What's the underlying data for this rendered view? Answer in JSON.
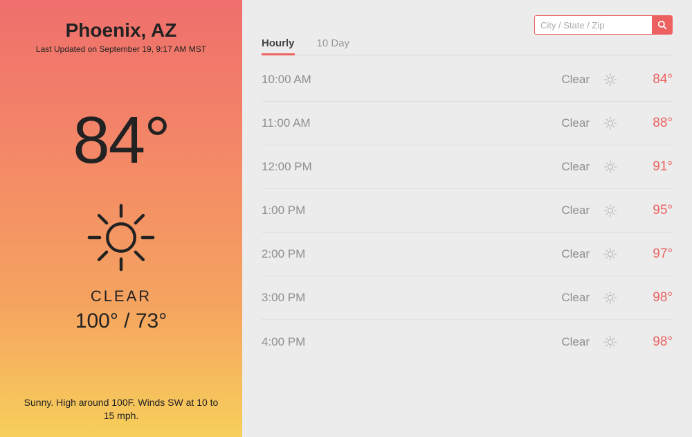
{
  "left": {
    "location": "Phoenix, AZ",
    "updated": "Last Updated on September 19, 9:17 AM MST",
    "temp": "84°",
    "condition": "CLEAR",
    "hi_lo": "100° / 73°",
    "summary": "Sunny. High around 100F. Winds SW at 10 to 15 mph."
  },
  "search": {
    "placeholder": "City / State / Zip"
  },
  "tabs": {
    "hourly": "Hourly",
    "tenday": "10 Day"
  },
  "rows": [
    {
      "time": "10:00 AM",
      "cond": "Clear",
      "temp": "84°"
    },
    {
      "time": "11:00 AM",
      "cond": "Clear",
      "temp": "88°"
    },
    {
      "time": "12:00 PM",
      "cond": "Clear",
      "temp": "91°"
    },
    {
      "time": "1:00 PM",
      "cond": "Clear",
      "temp": "95°"
    },
    {
      "time": "2:00 PM",
      "cond": "Clear",
      "temp": "97°"
    },
    {
      "time": "3:00 PM",
      "cond": "Clear",
      "temp": "98°"
    },
    {
      "time": "4:00 PM",
      "cond": "Clear",
      "temp": "98°"
    }
  ],
  "icons": {
    "sun": "sun-icon",
    "search": "search-icon"
  }
}
